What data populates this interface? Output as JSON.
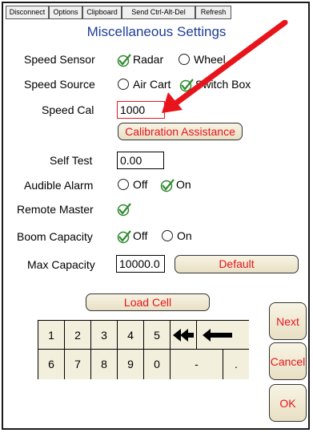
{
  "toolbar": {
    "disconnect": "Disconnect",
    "options": "Options",
    "clipboard": "Clipboard",
    "send_cad": "Send Ctrl-Alt-Del",
    "refresh": "Refresh"
  },
  "title": "Miscellaneous Settings",
  "speed_sensor": {
    "label": "Speed Sensor",
    "option1": "Radar",
    "option2": "Wheel",
    "selected": "Radar"
  },
  "speed_source": {
    "label": "Speed Source",
    "option1": "Air Cart",
    "option2": "Switch Box",
    "selected": "Switch Box"
  },
  "speed_cal": {
    "label": "Speed Cal",
    "value": "1000"
  },
  "calibration_button": "Calibration Assistance",
  "self_test": {
    "label": "Self Test",
    "value": "0.00"
  },
  "audible_alarm": {
    "label": "Audible Alarm",
    "option1": "Off",
    "option2": "On",
    "selected": "On"
  },
  "remote_master": {
    "label": "Remote Master",
    "checked": true
  },
  "boom_capacity": {
    "label": "Boom Capacity",
    "option1": "Off",
    "option2": "On",
    "selected": "Off"
  },
  "max_capacity": {
    "label": "Max Capacity",
    "value": "10000.0"
  },
  "default_button": "Default",
  "load_cell_button": "Load Cell",
  "side_buttons": {
    "next": "Next",
    "cancel": "Cancel",
    "ok": "OK"
  },
  "keypad": {
    "row1": [
      "1",
      "2",
      "3",
      "4",
      "5"
    ],
    "row2": [
      "6",
      "7",
      "8",
      "9",
      "0",
      "-",
      "."
    ],
    "backspace_all_icon": "double-left-arrow-icon",
    "backspace_icon": "left-arrow-icon"
  },
  "colors": {
    "accent_red": "#e8141c",
    "title_blue": "#1f3f96",
    "check_green": "#2e8b2e",
    "button_fill": "#efe8cf"
  }
}
